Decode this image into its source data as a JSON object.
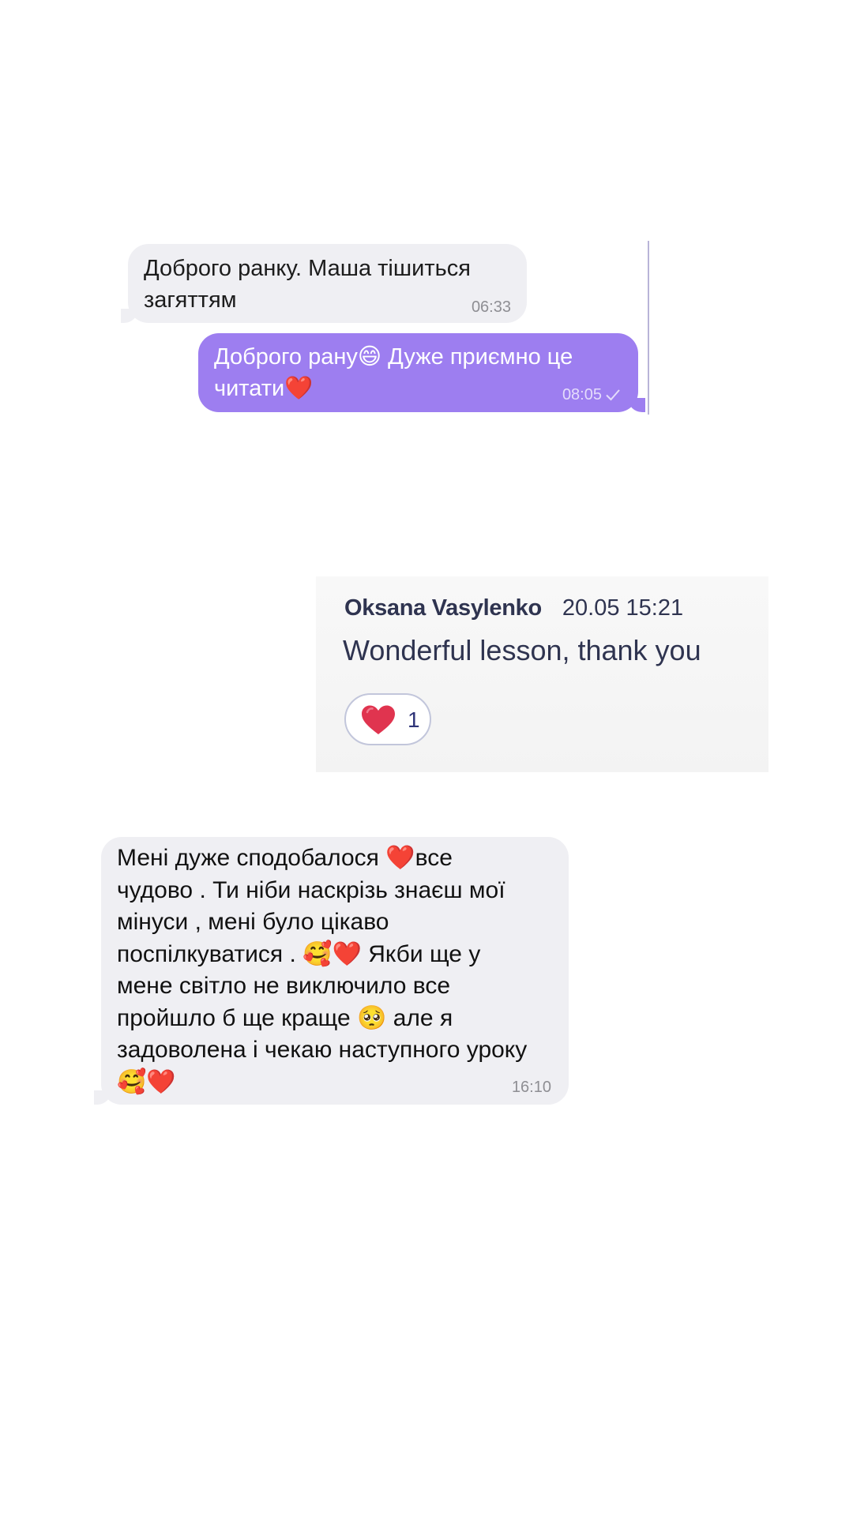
{
  "chat1": {
    "incoming": {
      "text": "Доброго ранку.  Маша тішиться загяттям",
      "time": "06:33"
    },
    "outgoing": {
      "text": "Доброго рану😄 Дуже приємно це читати❤️",
      "time": "08:05",
      "status_icon": "single-check-icon"
    }
  },
  "comment": {
    "author": "Oksana Vasylenko",
    "datetime": "20.05 15:21",
    "text": "Wonderful lesson, thank you",
    "reaction": {
      "icon": "heart-icon",
      "count": "1"
    }
  },
  "chat2": {
    "incoming": {
      "text": "Мені дуже сподобалося ❤️все\nчудово . Ти ніби наскрізь знаєш мої\nмінуси , мені було цікаво\nпоспілкуватися . 🥰❤️ Якби ще у\nмене світло не виключило все\nпройшло б ще краще 🥺 але я\nзадоволена і чекаю наступного уроку\n🥰❤️",
      "time": "16:10"
    }
  },
  "colors": {
    "incoming_bubble": "#efeff3",
    "outgoing_bubble": "#9d7ef0",
    "comment_text": "#2f3450",
    "reaction_heart": "#e0344f"
  }
}
